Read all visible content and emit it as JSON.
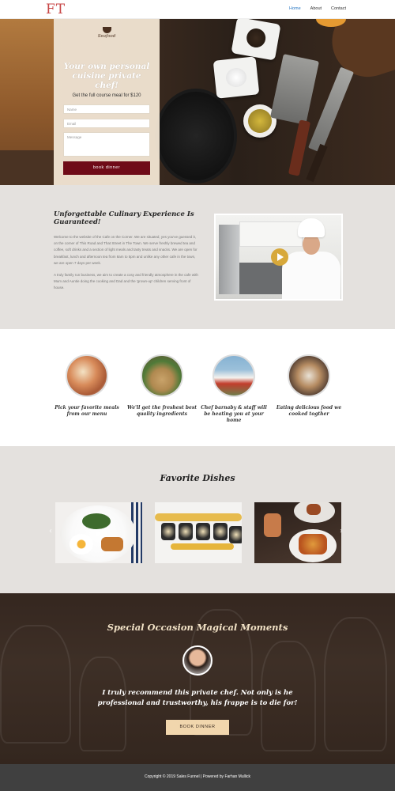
{
  "header": {
    "logo": "FT",
    "nav": [
      "Home",
      "About",
      "Contact"
    ],
    "active_nav": "Home"
  },
  "hero": {
    "brand": "Seafood",
    "title": "Your own personal cuisine private chef!",
    "subtitle": "Get the full course meal for $120",
    "form": {
      "name_placeholder": "Name",
      "email_placeholder": "Email",
      "message_placeholder": "Message",
      "button": "book dinner"
    }
  },
  "intro": {
    "title": "Unforgettable Culinary Experience Is Guaranteed!",
    "paragraph1": "Welcome to the website of the Cafe on the Corner. We are situated, yes you've guessed it, on the corner of This Road and That Street in The Town. We serve freshly brewed tea and coffee, soft drinks and a section of light meals and tasty treats and snacks. We are open for breakfast, lunch and afternoon tea from 8am to 5pm and unlike any other cafe in the town, we are open 7 days per week.",
    "paragraph2": "A truly family run business, we aim to create a cosy and friendly atmosphere in the cafe with Mum and Auntie doing the cooking and Dad and the 'grown-up' children serving front of house.",
    "video_play_icon": "play-icon"
  },
  "features": [
    {
      "label": "Pick your favorite meals from our menu"
    },
    {
      "label": "We'll get the freshest best quality ingredients"
    },
    {
      "label": "Chef barnaby & staff will be heating you at your home"
    },
    {
      "label": "Eating delicious food we cooked togther"
    }
  ],
  "dishes": {
    "title": "Favorite Dishes",
    "prev_icon": "chevron-left-icon",
    "next_icon": "chevron-right-icon"
  },
  "testimonial": {
    "title": "Special Occasion Magical Moments",
    "quote": "I truly recommend this private chef. Not only is he professional and trustworthy, his frappe is to die for!",
    "button": "BOOK DINNER"
  },
  "footer": {
    "text": "Copyright © 2019 Sales Funnel | Powered by Farhan Mullick"
  },
  "colors": {
    "accent_red": "#6f0b18",
    "logo_red": "#c84747",
    "cream": "#f1d6ad",
    "section_gray": "#e4e1de",
    "footer_gray": "#404040"
  }
}
